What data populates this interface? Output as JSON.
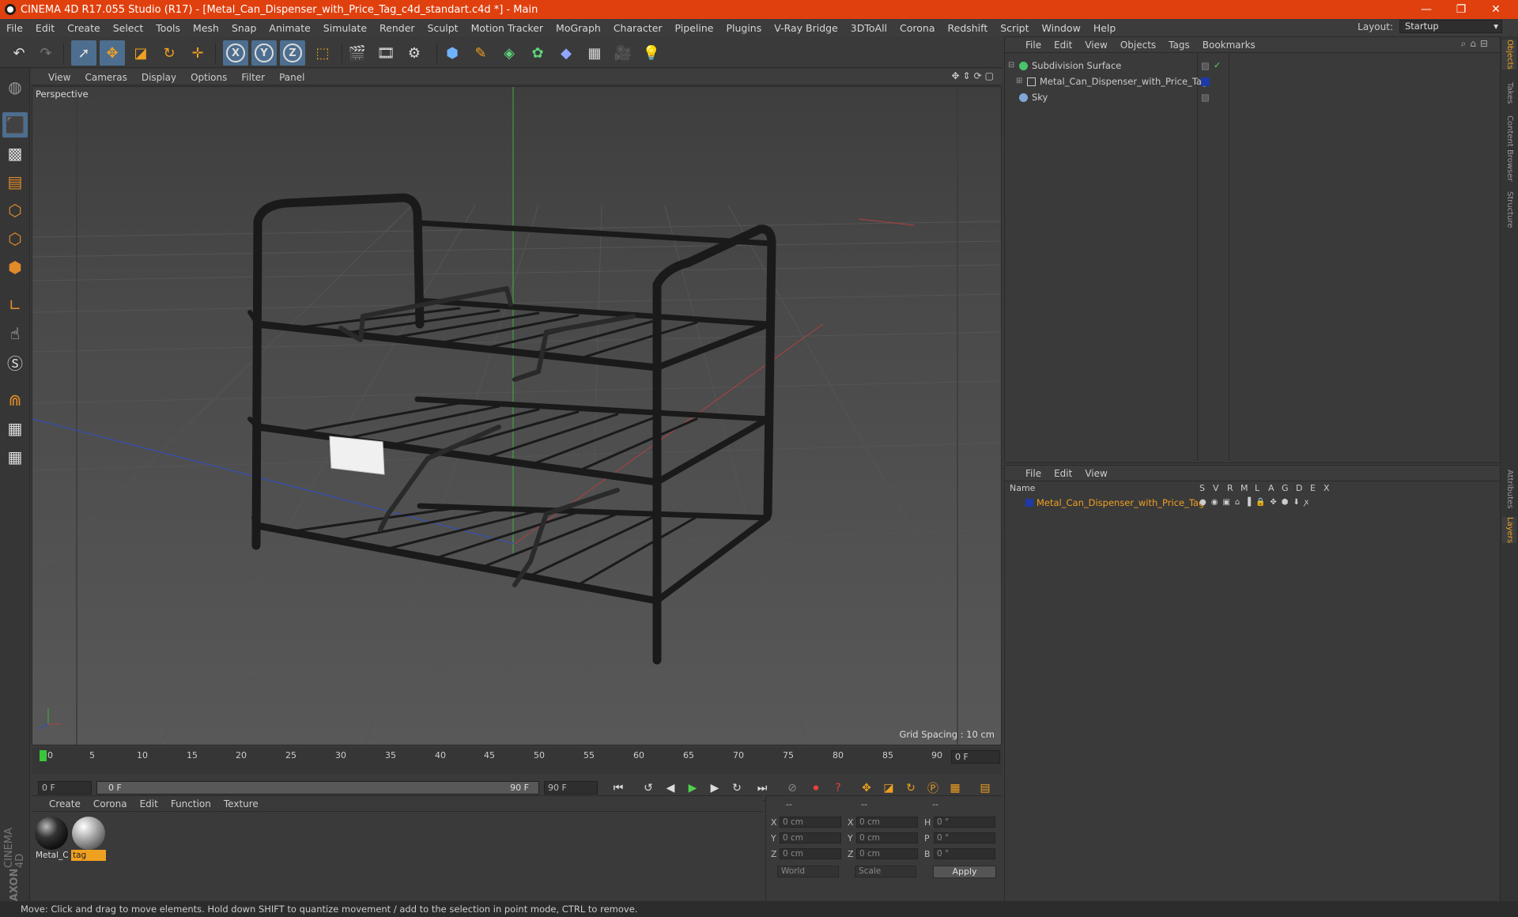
{
  "window": {
    "title": "CINEMA 4D R17.055 Studio (R17) - [Metal_Can_Dispenser_with_Price_Tag_c4d_standart.c4d *] - Main",
    "minimize": "—",
    "restore": "❐",
    "close": "✕"
  },
  "menu": [
    "File",
    "Edit",
    "Create",
    "Select",
    "Tools",
    "Mesh",
    "Snap",
    "Animate",
    "Simulate",
    "Render",
    "Sculpt",
    "Motion Tracker",
    "MoGraph",
    "Character",
    "Pipeline",
    "Plugins",
    "V-Ray Bridge",
    "3DToAll",
    "Corona",
    "Redshift",
    "Script",
    "Window",
    "Help"
  ],
  "layout": {
    "label": "Layout:",
    "value": "Startup"
  },
  "toolbar": {
    "x_axis": "X",
    "y_axis": "Y",
    "z_axis": "Z"
  },
  "viewport": {
    "menu": [
      "View",
      "Cameras",
      "Display",
      "Options",
      "Filter",
      "Panel"
    ],
    "label": "Perspective",
    "grid_spacing": "Grid Spacing : 10 cm"
  },
  "timeline": {
    "ticks": [
      "0",
      "5",
      "10",
      "15",
      "20",
      "25",
      "30",
      "35",
      "40",
      "45",
      "50",
      "55",
      "60",
      "65",
      "70",
      "75",
      "80",
      "85",
      "90"
    ],
    "current_frame": "0 F",
    "start_field": "0 F",
    "range_start": "0 F",
    "range_end": "90 F",
    "end_field": "90 F"
  },
  "materials": {
    "menu": [
      "Create",
      "Corona",
      "Edit",
      "Function",
      "Texture"
    ],
    "items": [
      {
        "name": "Metal_C",
        "selected": false
      },
      {
        "name": "tag",
        "selected": true
      }
    ]
  },
  "coords": {
    "header": [
      "--",
      "--",
      "--"
    ],
    "rows": [
      {
        "a": "X",
        "av": "0 cm",
        "b": "X",
        "bv": "0 cm",
        "c": "H",
        "cv": "0 °"
      },
      {
        "a": "Y",
        "av": "0 cm",
        "b": "Y",
        "bv": "0 cm",
        "c": "P",
        "cv": "0 °"
      },
      {
        "a": "Z",
        "av": "0 cm",
        "b": "Z",
        "bv": "0 cm",
        "c": "B",
        "cv": "0 °"
      }
    ],
    "space": "World",
    "mode": "Scale",
    "apply": "Apply"
  },
  "objects": {
    "menu": [
      "File",
      "Edit",
      "View",
      "Objects",
      "Tags",
      "Bookmarks"
    ],
    "items": [
      {
        "name": "Subdivision Surface",
        "icon_color": "#49c46a"
      },
      {
        "name": "Metal_Can_Dispenser_with_Price_Tag",
        "icon_color": "#c8c8c8"
      },
      {
        "name": "Sky",
        "icon_color": "#7fa8d8"
      }
    ]
  },
  "layers": {
    "menu": [
      "File",
      "Edit",
      "View"
    ],
    "columns": [
      "Name",
      "S",
      "V",
      "R",
      "M",
      "L",
      "A",
      "G",
      "D",
      "E",
      "X"
    ],
    "rows": [
      {
        "name": "Metal_Can_Dispenser_with_Price_Tag",
        "color": "#1e3aa8"
      }
    ]
  },
  "right_tabs": [
    "Objects",
    "Takes",
    "Content Browser",
    "Structure",
    "Attributes",
    "Layers"
  ],
  "brand": {
    "line1": "MAXON",
    "line2": "CINEMA 4D"
  },
  "status": "Move: Click and drag to move elements. Hold down SHIFT to quantize movement / add to the selection in point mode, CTRL to remove.",
  "colors": {
    "title_bar": "#e0400e",
    "accent_blue": "#4d6e8f",
    "layer_highlight": "#f0a020"
  }
}
